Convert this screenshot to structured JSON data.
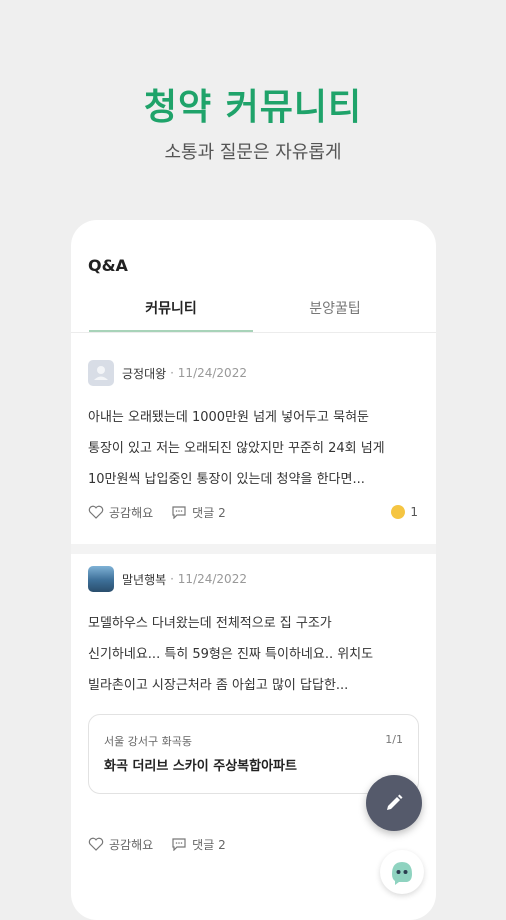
{
  "hero": {
    "title": "청약 커뮤니티",
    "subtitle": "소통과 질문은 자유롭게"
  },
  "card": {
    "title": "Q&A",
    "tabs": [
      {
        "label": "커뮤니티",
        "active": true
      },
      {
        "label": "분양꿀팁",
        "active": false
      }
    ]
  },
  "posts": [
    {
      "author": "긍정대왕",
      "date": "· 11/24/2022",
      "body_lines": [
        "아내는 오래됐는데 1000만원 넘게 넣어두고 묵혀둔",
        "통장이 있고 저는 오래되진 않았지만 꾸준히 24회 넘게",
        "10만원씩 납입중인 통장이 있는데 청약을 한다면..."
      ],
      "like_label": "공감해요",
      "comment_label": "댓글 2",
      "reaction_count": "1"
    },
    {
      "author": "말년행복",
      "date": "· 11/24/2022",
      "body_lines": [
        "모델하우스 다녀왔는데 전체적으로 집 구조가",
        "신기하네요... 특히 59형은 진짜 특이하네요.. 위치도",
        "빌라촌이고 시장근처라 좀 아쉽고 많이 답답한..."
      ],
      "reference": {
        "location": "서울 강서구 화곡동",
        "page": "1/1",
        "name": "화곡 더리브 스카이 주상복합아파트"
      },
      "like_label": "공감해요",
      "comment_label": "댓글 2"
    }
  ],
  "colors": {
    "accent": "#1fa36a",
    "fab": "#555a6b",
    "tab_underline": "#a8d3b9"
  },
  "icons": {
    "fab": "pencil-icon",
    "mascot": "mascot-icon"
  }
}
